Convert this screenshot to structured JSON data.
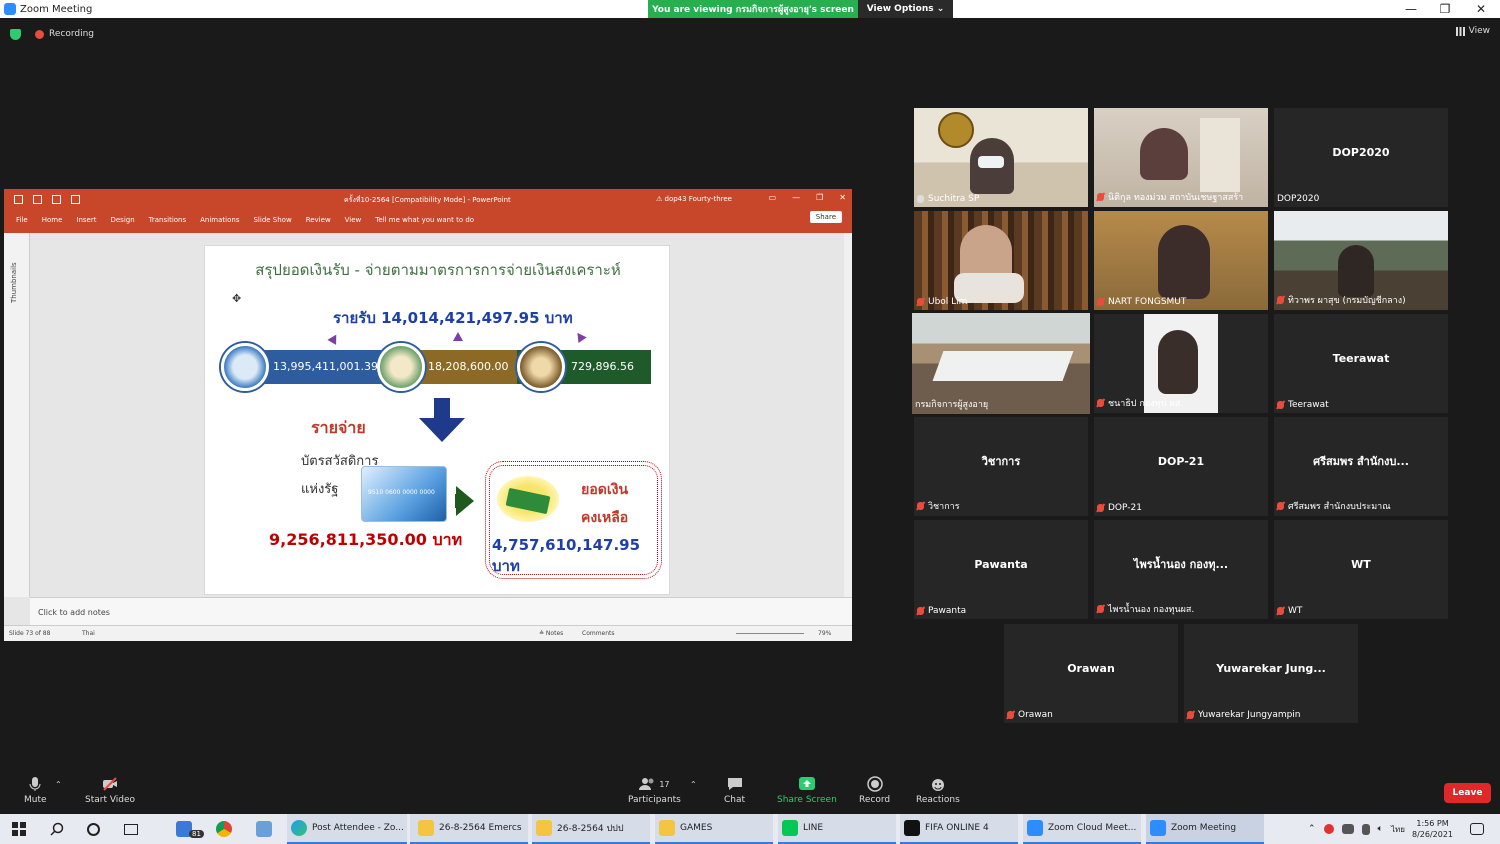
{
  "window": {
    "title": "Zoom Meeting",
    "viewing_banner": "You are viewing กรมกิจการผู้สูงอายุ's screen",
    "view_options": "View Options ⌄",
    "minimize": "—",
    "restore": "❐",
    "close": "✕"
  },
  "status": {
    "recording": "Recording",
    "view": "View"
  },
  "ppt": {
    "title": "ครั้งที่10-2564 [Compatibility Mode] - PowerPoint",
    "user": "⚠ dop43 Fourty-three",
    "menu": [
      "File",
      "Home",
      "Insert",
      "Design",
      "Transitions",
      "Animations",
      "Slide Show",
      "Review",
      "View",
      "Tell me what you want to do"
    ],
    "share": "Share",
    "thumbnails": "Thumbnails",
    "notes_placeholder": "Click to add notes",
    "status_slide": "Slide 73 of 88",
    "status_lang": "Thai",
    "status_notes": "≙ Notes",
    "status_comments": "Comments",
    "zoom": "79%"
  },
  "slide": {
    "title": "สรุปยอดเงินรับ - จ่ายตามมาตรการการจ่ายเงินสงเคราะห์",
    "income": "รายรับ 14,014,421,497.95 บาท",
    "val1": "13,995,411,001.39",
    "val2": "18,208,600.00",
    "val3": "729,896.56",
    "expense_label": "รายจ่าย",
    "card_line1": "บัตรสวัสดิการ",
    "card_line2": "แห่งรัฐ",
    "card_number": "9510 0600 0000 0000",
    "expense_value": "9,256,811,350.00 บาท",
    "remain_line1": "ยอดเงิน",
    "remain_line2": "คงเหลือ",
    "remain_value": "4,757,610,147.95 บาท"
  },
  "participants": [
    {
      "name": "Suchitra SP",
      "muted": false,
      "video": true
    },
    {
      "name": "นิติกุล ทองม่วม สถาบันเชษฐาสสร้า",
      "muted": true,
      "video": true
    },
    {
      "name": "DOP2020",
      "muted": false,
      "video": false
    },
    {
      "name": "Ubol Lim",
      "muted": true,
      "video": true
    },
    {
      "name": "NART FONGSMUT",
      "muted": true,
      "video": true
    },
    {
      "name": "ทิวาพร ผาสุข (กรมบัญชีกลาง)",
      "muted": true,
      "video": true
    },
    {
      "name": "กรมกิจการผู้สูงอายุ",
      "muted": false,
      "video": true
    },
    {
      "name": "ชนาธิป กองทุน ผส.",
      "muted": true,
      "video": true
    },
    {
      "name": "Teerawat",
      "muted": true,
      "video": false
    },
    {
      "name": "วิชาการ",
      "muted": true,
      "video": false
    },
    {
      "name": "DOP-21",
      "muted": true,
      "video": false
    },
    {
      "name": "ศรีสมพร สำนักงบประมาณ",
      "muted": true,
      "video": false
    },
    {
      "name": "Pawanta",
      "muted": true,
      "video": false
    },
    {
      "name": "ไพรน้ำนอง กองทุนผส.",
      "muted": true,
      "video": false
    },
    {
      "name": "WT",
      "muted": true,
      "video": false
    },
    {
      "name": "Orawan",
      "muted": true,
      "video": false
    },
    {
      "name": "Yuwarekar Jungyampin",
      "muted": true,
      "video": false
    }
  ],
  "tile_centers": {
    "dop2020": "DOP2020",
    "teerawat": "Teerawat",
    "wichakan": "วิชาการ",
    "dop21": "DOP-21",
    "srisomporn": "ศรีสมพร สำนักงบ...",
    "pawanta": "Pawanta",
    "prainamnong": "ไพรน้ำนอง กองทุ...",
    "wt": "WT",
    "orawan": "Orawan",
    "yuwarekar": "Yuwarekar  Jung..."
  },
  "toolbar": {
    "mute": "Mute",
    "start_video": "Start Video",
    "participants": "Participants",
    "participant_count": "17",
    "chat": "Chat",
    "share_screen": "Share Screen",
    "record": "Record",
    "reactions": "Reactions",
    "leave": "Leave"
  },
  "taskbar": {
    "items": [
      "Post Attendee - Zo...",
      "26-8-2564 Emercs",
      "26-8-2564 ปปป",
      "GAMES",
      "LINE",
      "FIFA ONLINE 4",
      "Zoom Cloud Meet...",
      "Zoom Meeting"
    ],
    "mail_badge": "81",
    "lang": "ไทย",
    "time": "1:56 PM",
    "date": "8/26/2021"
  },
  "colors": {
    "accent_green": "#27ae4f",
    "ppt_red": "#c8462a",
    "leave_red": "#e02828"
  }
}
